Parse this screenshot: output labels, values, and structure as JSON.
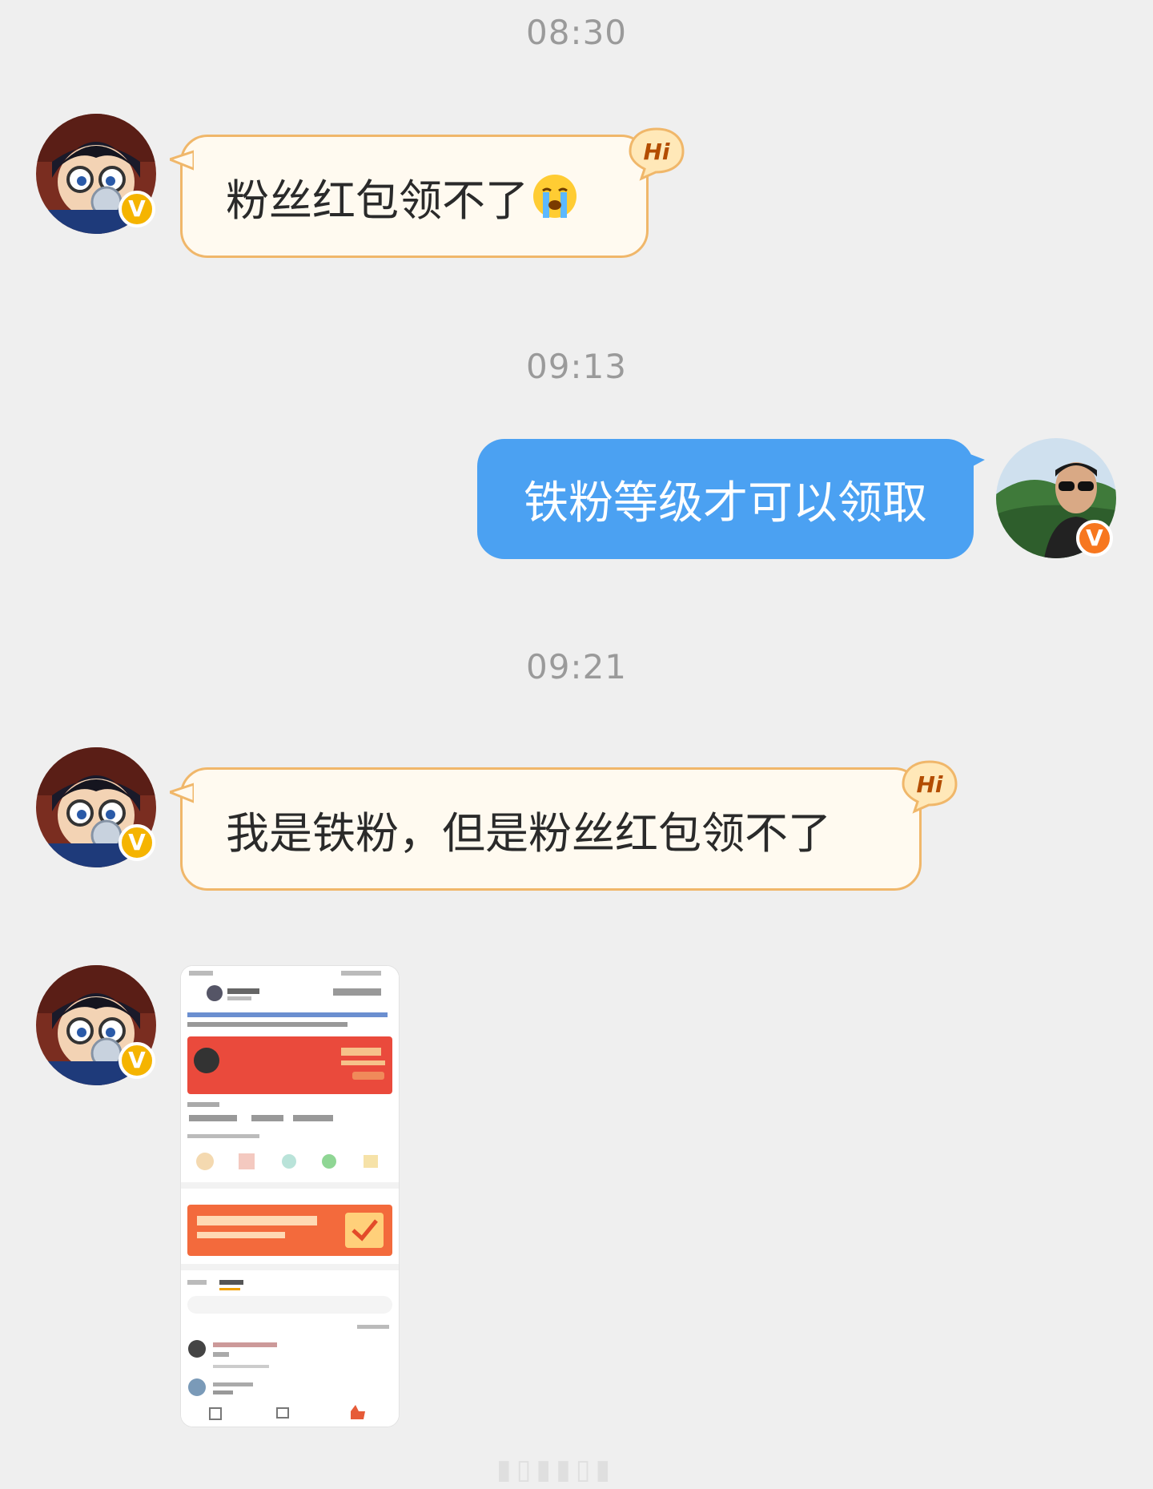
{
  "messages": [
    {
      "time": "08:30",
      "side": "in",
      "text": "粉丝红包领不了",
      "emoji": "loudly-crying-face-icon",
      "badge": "Hi"
    },
    {
      "time": "09:13",
      "side": "out",
      "text": "铁粉等级才可以领取"
    },
    {
      "time": "09:21",
      "side": "in",
      "text": "我是铁粉，但是粉丝红包领不了",
      "badge": "Hi"
    },
    {
      "side": "in",
      "type": "image",
      "image_desc": "screenshot-thumbnail"
    }
  ],
  "verified_badge": "V",
  "colors": {
    "background": "#efefef",
    "incoming_bubble": "#fffaf0",
    "incoming_border": "#f0b76a",
    "outgoing_bubble": "#4ba1f2",
    "badge_gold": "#f5b400",
    "badge_orange": "#f7771f"
  }
}
